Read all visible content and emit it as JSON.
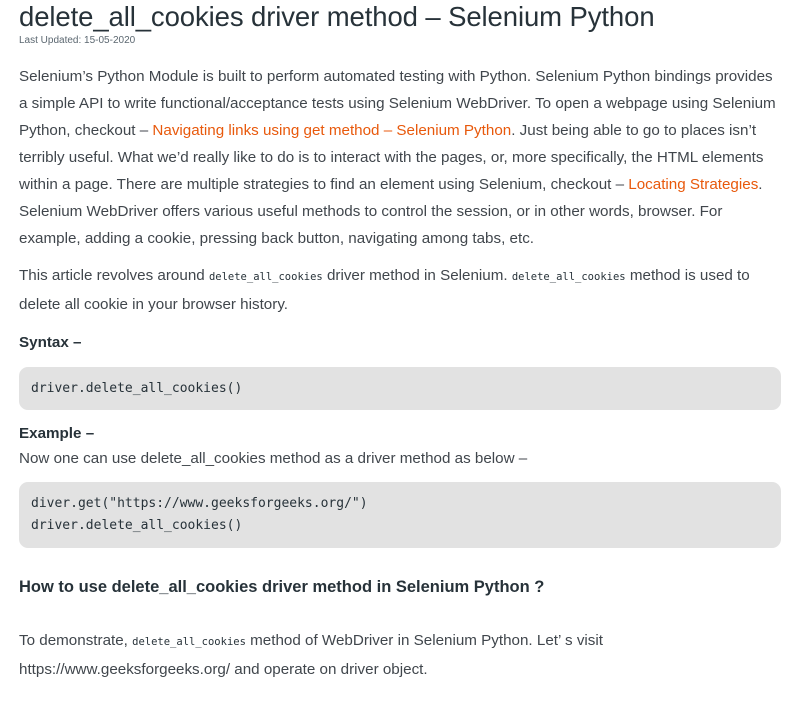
{
  "article": {
    "title": "delete_all_cookies driver method – Selenium Python",
    "last_updated": "Last Updated: 15-05-2020",
    "p1": {
      "t1": "Selenium’s Python Module is built to perform automated testing with Python. Selenium Python bindings provides a simple API to write functional/acceptance tests using Selenium WebDriver. To open a webpage using Selenium Python, checkout – ",
      "link1": "Navigating links using get method – Selenium Python",
      "t2": ". Just being able to go to places isn’t terribly useful. What we’d really like to do is to interact with the pages, or, more specifically, the HTML elements within a page. There are multiple strategies to find an element using Selenium, checkout – ",
      "link2": "Locating Strategies",
      "t3": ". Selenium WebDriver offers various useful methods to control the session, or in other words, browser. For example, adding a cookie, pressing back button, navigating among tabs, etc."
    },
    "p2": {
      "t1": "This article revolves around ",
      "code1": "delete_all_cookies",
      "t2": " driver method in Selenium. ",
      "code2": "delete_all_cookies",
      "t3": " method is used to delete all cookie in your browser history."
    },
    "syntax_heading": "Syntax –",
    "syntax_code": "driver.delete_all_cookies()",
    "example_heading": "Example –",
    "example_text": "Now one can use delete_all_cookies method as a driver method as below –",
    "example_code": [
      "diver.get(\"https://www.geeksforgeeks.org/\")",
      "driver.delete_all_cookies()"
    ],
    "how_to_heading": "How to use delete_all_cookies driver method in Selenium Python ?",
    "p4": {
      "t1": "To demonstrate, ",
      "code": "delete_all_cookies",
      "t2": " method of WebDriver in Selenium Python. Let’ s visit https://www.geeksforgeeks.org/ and operate on driver object."
    }
  },
  "colors": {
    "text": "#40464c",
    "heading": "#273239",
    "link": "#e8590c",
    "code_background": "#e2e2e2"
  }
}
